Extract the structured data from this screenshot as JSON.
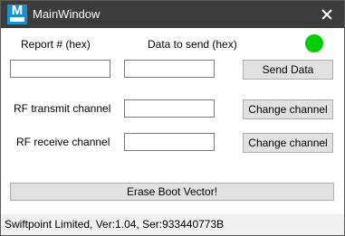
{
  "window": {
    "title": "MainWindow",
    "icon_letter": "M"
  },
  "labels": {
    "report": "Report # (hex)",
    "data": "Data to send (hex)",
    "rf_transmit": "RF transmit channel",
    "rf_receive": "RF receive channel"
  },
  "inputs": {
    "report_value": "",
    "data_value": "",
    "rf_transmit_value": "",
    "rf_receive_value": ""
  },
  "buttons": {
    "send_data": "Send Data",
    "change_tx": "Change channel",
    "change_rx": "Change channel",
    "erase_boot": "Erase Boot Vector!"
  },
  "status": {
    "led_color": "#00cc00",
    "text": "Swiftpoint Limited, Ver:1.04, Ser:933440773B"
  }
}
